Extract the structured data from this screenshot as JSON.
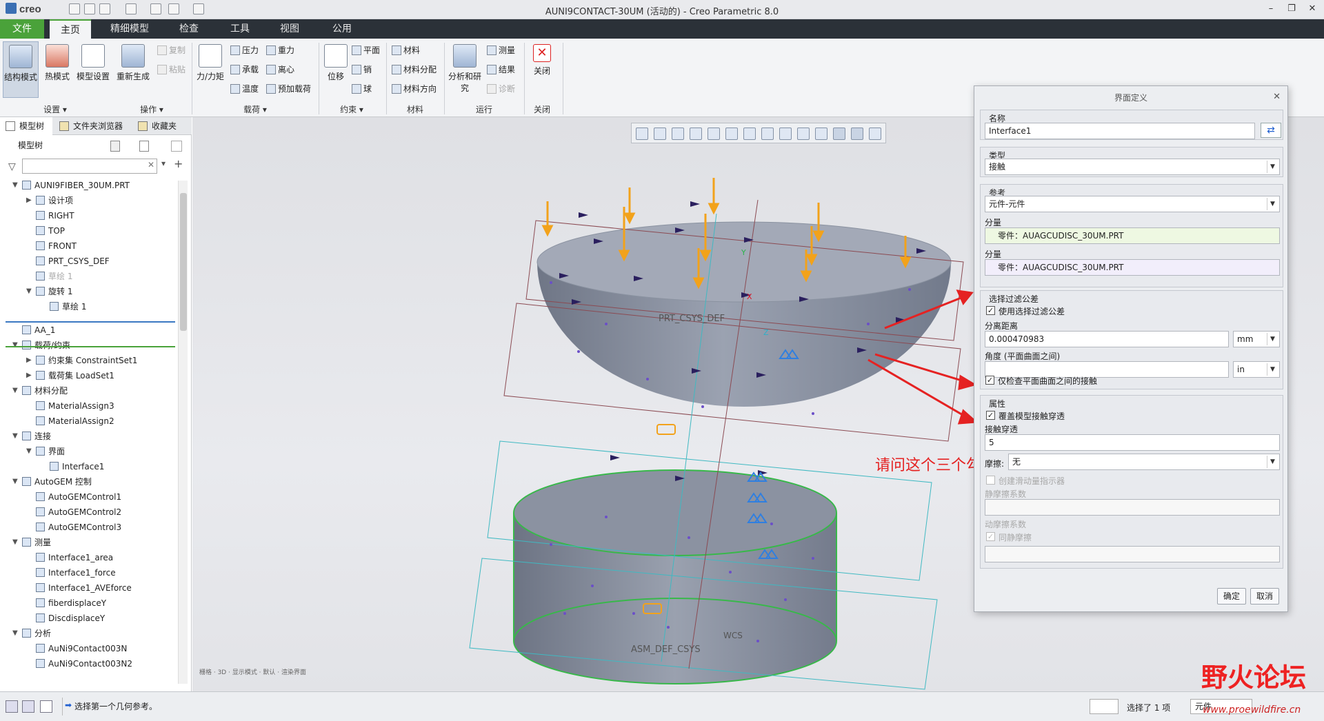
{
  "titlebar": {
    "logo": "creo",
    "title": "AUNI9CONTACT-30UM (活动的) - Creo Parametric 8.0"
  },
  "menu": {
    "tabs": [
      "文件",
      "主页",
      "精细模型",
      "检查",
      "工具",
      "视图",
      "公用"
    ],
    "active": "主页"
  },
  "ribbon": {
    "big_buttons": [
      {
        "label": "结构模式",
        "selected": true
      },
      {
        "label": "热模式",
        "selected": false
      },
      {
        "label": "模型设置",
        "selected": false
      },
      {
        "label": "重新生成",
        "selected": false
      },
      {
        "label": "力/力矩",
        "selected": false
      },
      {
        "label": "位移",
        "selected": false
      },
      {
        "label": "分析和研究",
        "selected": false
      },
      {
        "label": "关闭",
        "selected": false
      }
    ],
    "small_buttons": [
      {
        "label": "复制",
        "disabled": true
      },
      {
        "label": "粘贴",
        "disabled": true
      },
      {
        "label": "压力",
        "disabled": false
      },
      {
        "label": "承载",
        "disabled": false
      },
      {
        "label": "温度",
        "disabled": false
      },
      {
        "label": "重力",
        "disabled": false
      },
      {
        "label": "离心",
        "disabled": false
      },
      {
        "label": "预加载荷",
        "disabled": false
      },
      {
        "label": "平面",
        "disabled": false
      },
      {
        "label": "销",
        "disabled": false
      },
      {
        "label": "球",
        "disabled": false
      },
      {
        "label": "材料",
        "disabled": false
      },
      {
        "label": "材料分配",
        "disabled": false
      },
      {
        "label": "材料方向",
        "disabled": false
      },
      {
        "label": "测量",
        "disabled": false
      },
      {
        "label": "结果",
        "disabled": false
      },
      {
        "label": "诊断",
        "disabled": true
      }
    ],
    "groups": [
      "设置 ▾",
      "操作 ▾",
      "载荷 ▾",
      "约束 ▾",
      "材料",
      "运行",
      "关闭"
    ]
  },
  "left_panel": {
    "tabs": [
      "模型树",
      "文件夹浏览器",
      "收藏夹"
    ],
    "header": "模型树",
    "tree": [
      {
        "label": "AUNI9FIBER_30UM.PRT",
        "level": 0,
        "toggle": "▼",
        "grey": false
      },
      {
        "label": "设计项",
        "level": 1,
        "toggle": "▶",
        "grey": false
      },
      {
        "label": "RIGHT",
        "level": 1,
        "toggle": "",
        "grey": false
      },
      {
        "label": "TOP",
        "level": 1,
        "toggle": "",
        "grey": false
      },
      {
        "label": "FRONT",
        "level": 1,
        "toggle": "",
        "grey": false
      },
      {
        "label": "PRT_CSYS_DEF",
        "level": 1,
        "toggle": "",
        "grey": false
      },
      {
        "label": "草绘 1",
        "level": 1,
        "toggle": "",
        "grey": true
      },
      {
        "label": "旋转 1",
        "level": 1,
        "toggle": "▼",
        "grey": false
      },
      {
        "label": "草绘 1",
        "level": 2,
        "toggle": "",
        "grey": false
      },
      {
        "label": "AA_1",
        "level": 0,
        "toggle": "",
        "grey": false
      },
      {
        "label": "载荷/约束",
        "level": 0,
        "toggle": "▼",
        "grey": false
      },
      {
        "label": "约束集 ConstraintSet1",
        "level": 1,
        "toggle": "▶",
        "grey": false
      },
      {
        "label": "载荷集 LoadSet1",
        "level": 1,
        "toggle": "▶",
        "grey": false
      },
      {
        "label": "材料分配",
        "level": 0,
        "toggle": "▼",
        "grey": false
      },
      {
        "label": "MaterialAssign3",
        "level": 1,
        "toggle": "",
        "grey": false
      },
      {
        "label": "MaterialAssign2",
        "level": 1,
        "toggle": "",
        "grey": false
      },
      {
        "label": "连接",
        "level": 0,
        "toggle": "▼",
        "grey": false
      },
      {
        "label": "界面",
        "level": 1,
        "toggle": "▼",
        "grey": false
      },
      {
        "label": "Interface1",
        "level": 2,
        "toggle": "",
        "grey": false
      },
      {
        "label": "AutoGEM 控制",
        "level": 0,
        "toggle": "▼",
        "grey": false
      },
      {
        "label": "AutoGEMControl1",
        "level": 1,
        "toggle": "",
        "grey": false
      },
      {
        "label": "AutoGEMControl2",
        "level": 1,
        "toggle": "",
        "grey": false
      },
      {
        "label": "AutoGEMControl3",
        "level": 1,
        "toggle": "",
        "grey": false
      },
      {
        "label": "测量",
        "level": 0,
        "toggle": "▼",
        "grey": false
      },
      {
        "label": "Interface1_area",
        "level": 1,
        "toggle": "",
        "grey": false
      },
      {
        "label": "Interface1_force",
        "level": 1,
        "toggle": "",
        "grey": false
      },
      {
        "label": "Interface1_AVEforce",
        "level": 1,
        "toggle": "",
        "grey": false
      },
      {
        "label": "fiberdisplaceY",
        "level": 1,
        "toggle": "",
        "grey": false
      },
      {
        "label": "DiscdisplaceY",
        "level": 1,
        "toggle": "",
        "grey": false
      },
      {
        "label": "分析",
        "level": 0,
        "toggle": "▼",
        "grey": false
      },
      {
        "label": "AuNi9Contact003N",
        "level": 1,
        "toggle": "",
        "grey": false
      },
      {
        "label": "AuNi9Contact003N2",
        "level": 1,
        "toggle": "",
        "grey": false
      }
    ]
  },
  "viewport": {
    "labels": {
      "prt_csys": "PRT_CSYS_DEF",
      "asm_csys": "ASM_DEF_CSYS",
      "wcs": "WCS",
      "x": "X",
      "y": "Y",
      "z": "Z"
    },
    "annotation": "请问这个三个勾选是代表什么",
    "status_hint": "栅格 · 3D · 显示模式 · 默认 · 渲染界面"
  },
  "dialog": {
    "title": "界面定义",
    "name_label": "名称",
    "name_value": "Interface1",
    "type_label": "类型",
    "type_value": "接触",
    "ref_label": "参考",
    "ref_value": "元件-元件",
    "comp1_label": "分量",
    "comp1_value": "零件：AUAGCUDISC_30UM.PRT",
    "comp2_label": "分量",
    "comp2_value": "零件：AUAGCUDISC_30UM.PRT",
    "filter_title": "选择过滤公差",
    "use_filter": "使用选择过滤公差",
    "sep_dist_label": "分离距离",
    "sep_dist_value": "0.000470983",
    "sep_unit": "mm",
    "angle_label": "角度 (平面曲面之间)",
    "angle_value": "",
    "angle_unit": "in",
    "planar_only": "仅检查平面曲面之间的接触",
    "props_title": "属性",
    "override": "覆盖模型接触穿透",
    "penetration_label": "接触穿透",
    "penetration_value": "5",
    "friction_label": "摩擦:",
    "friction_value": "无",
    "slip_indicator": "创建滑动量指示器",
    "static_friction_label": "静摩擦系数",
    "dynamic_friction_label": "动摩擦系数",
    "same_static": "同静摩擦",
    "ok": "确定",
    "cancel": "取消"
  },
  "statusbar": {
    "message": "选择第一个几何参考。",
    "selection": "选择了 1 项",
    "filter": "元件"
  },
  "watermark": {
    "text": "野火论坛",
    "url": "www.proewildfire.cn"
  }
}
